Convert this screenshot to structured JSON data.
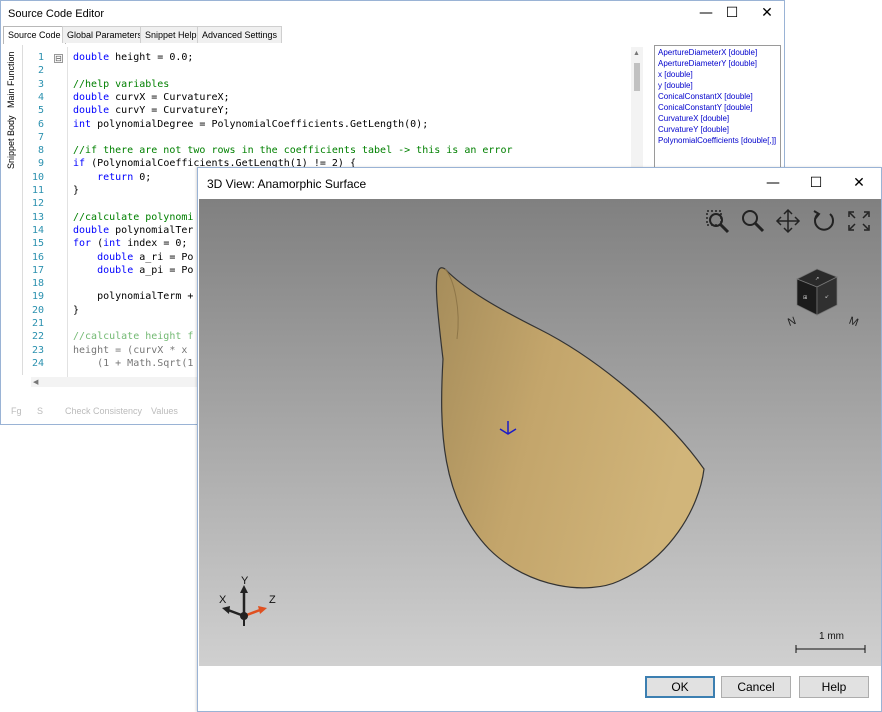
{
  "editor": {
    "title": "Source Code Editor",
    "window_controls": [
      "—",
      "☐",
      "✕"
    ],
    "tabs": [
      "Source Code",
      "Global Parameters",
      "Snippet Help",
      "Advanced Settings"
    ],
    "side_tabs": [
      "Main Function",
      "Snippet Body"
    ],
    "line_numbers": [
      "1",
      "2",
      "3",
      "4",
      "5",
      "6",
      "7",
      "8",
      "9",
      "10",
      "11",
      "12",
      "13",
      "14",
      "15",
      "16",
      "17",
      "18",
      "19",
      "20",
      "21",
      "22",
      "23",
      "24"
    ],
    "code_lines": [
      "double height = 0.0;",
      "",
      "//help variables",
      "double curvX = CurvatureX;",
      "double curvY = CurvatureY;",
      "int polynomialDegree = PolynomialCoefficients.GetLength(0);",
      "",
      "//if there are not two rows in the coefficients tabel -> this is an error",
      "if (PolynomialCoefficients.GetLength(1) != 2) {",
      "    return 0;",
      "}",
      "",
      "//calculate polynomi",
      "double polynomialTer",
      "for (int index = 0;",
      "    double a_ri = Po",
      "    double a_pi = Po",
      "",
      "    polynomialTerm +",
      "}",
      "",
      "//calculate height f",
      "height = (curvX * x",
      "    (1 + Math.Sqrt(1"
    ],
    "parameters": [
      "ApertureDiameterX [double]",
      "ApertureDiameterY [double]",
      "x [double]",
      "y [double]",
      "ConicalConstantX [double]",
      "ConicalConstantY [double]",
      "CurvatureX [double]",
      "CurvatureY [double]",
      "PolynomialCoefficients [double[,]]"
    ],
    "bottom_items": [
      "Fg",
      "S",
      "Check Consistency",
      "Values"
    ]
  },
  "view3d": {
    "title": "3D View: Anamorphic Surface",
    "window_controls": [
      "—",
      "☐",
      "✕"
    ],
    "toolbar_icons": [
      "zoom-window-icon",
      "zoom-icon",
      "pan-icon",
      "rotate-icon",
      "fit-view-icon"
    ],
    "view_cube": {
      "edge_labels": [
        "N",
        "M"
      ]
    },
    "axes": {
      "x": "X",
      "y": "Y",
      "z": "Z"
    },
    "scale_bar_label": "1 mm",
    "buttons": {
      "ok": "OK",
      "cancel": "Cancel",
      "help": "Help"
    },
    "colors": {
      "surface": "#c9aa6c",
      "viewport_top": "#808080",
      "viewport_bottom": "#d0d0d0",
      "marker": "#1a1ac8",
      "z_axis": "#e05020"
    }
  }
}
